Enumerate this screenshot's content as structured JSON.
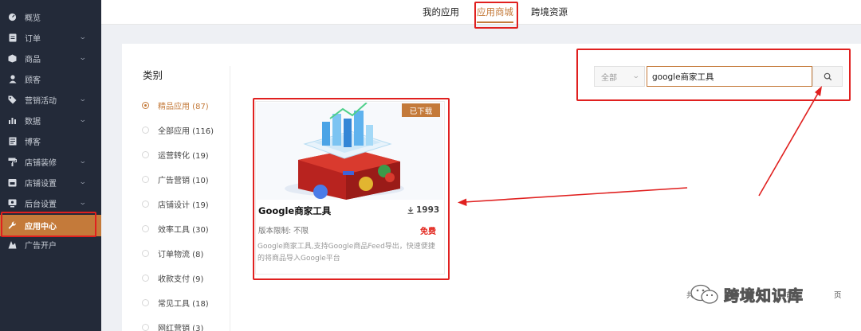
{
  "sidebar": {
    "items": [
      {
        "label": "概览",
        "icon": "dashboard-icon",
        "has_arrow": false
      },
      {
        "label": "订单",
        "icon": "order-icon",
        "has_arrow": true
      },
      {
        "label": "商品",
        "icon": "box-icon",
        "has_arrow": true
      },
      {
        "label": "顾客",
        "icon": "user-icon",
        "has_arrow": false
      },
      {
        "label": "营销活动",
        "icon": "tag-icon",
        "has_arrow": true
      },
      {
        "label": "数据",
        "icon": "bar-chart-icon",
        "has_arrow": true
      },
      {
        "label": "博客",
        "icon": "blog-icon",
        "has_arrow": false
      },
      {
        "label": "店铺装修",
        "icon": "paint-roller-icon",
        "has_arrow": true
      },
      {
        "label": "店铺设置",
        "icon": "store-icon",
        "has_arrow": true
      },
      {
        "label": "后台设置",
        "icon": "settings-icon",
        "has_arrow": true
      },
      {
        "label": "应用中心",
        "icon": "wrench-icon",
        "has_arrow": false,
        "active": true
      },
      {
        "label": "广告开户",
        "icon": "ad-icon",
        "has_arrow": false
      }
    ]
  },
  "tabs": [
    {
      "label": "我的应用"
    },
    {
      "label": "应用商城",
      "active": true
    },
    {
      "label": "跨境资源"
    }
  ],
  "categories": {
    "title": "类别",
    "items": [
      {
        "label": "精品应用 (87)",
        "active": true
      },
      {
        "label": "全部应用 (116)"
      },
      {
        "label": "运营转化 (19)"
      },
      {
        "label": "广告营销 (10)"
      },
      {
        "label": "店铺设计 (19)"
      },
      {
        "label": "效率工具 (30)"
      },
      {
        "label": "订单物流 (8)"
      },
      {
        "label": "收款支付 (9)"
      },
      {
        "label": "常见工具 (18)"
      },
      {
        "label": "网红营销 (3)"
      }
    ]
  },
  "search": {
    "scope": "全部",
    "value": "google商家工具"
  },
  "app": {
    "badge": "已下载",
    "title": "Google商家工具",
    "downloads": "1993",
    "limit_label": "版本限制:",
    "limit_value": "不限",
    "price": "免费",
    "description": "Google商家工具,支持Google商品Feed导出，快速便捷的将商品导入Google平台"
  },
  "watermark": "跨境知识库",
  "pagination": {
    "left_fragment": "共",
    "mid_fragment": "前",
    "right_fragment": "页"
  },
  "colors": {
    "accent": "#c47a3a",
    "sidebar_bg": "#232a39",
    "annotation_red": "#e0201f",
    "price_red": "#e2231a"
  }
}
